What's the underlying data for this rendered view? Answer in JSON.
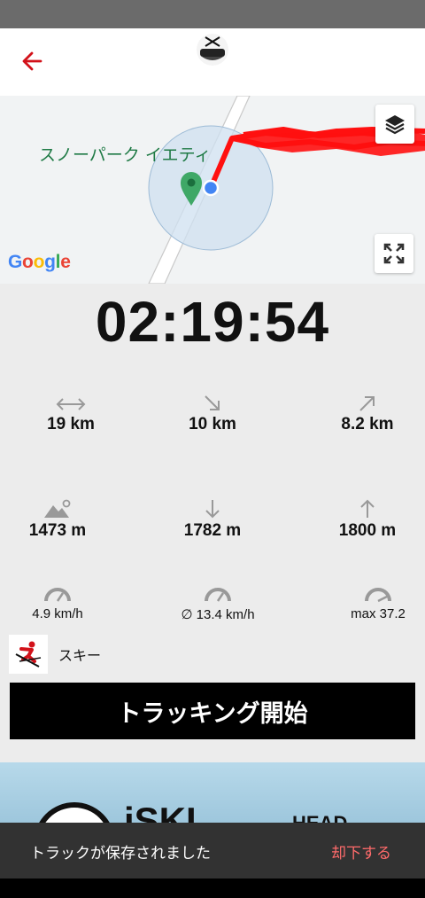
{
  "map": {
    "place_label": "スノーパーク イエティ",
    "attribution": "Google",
    "attribution_colors": [
      "#4285F4",
      "#EA4335",
      "#FBBC05",
      "#4285F4",
      "#34A853",
      "#EA4335"
    ]
  },
  "timer": "02:19:54",
  "stats": {
    "distance": "19 km",
    "descent_distance": "10 km",
    "ascent_distance": "8.2 km",
    "altitude": "1473 m",
    "descent_vertical": "1782 m",
    "ascent_vertical": "1800 m",
    "speed": "4.9 km/h",
    "avg_speed": "∅ 13.4 km/h",
    "max_speed": "max 37.2"
  },
  "activity": {
    "label": "スキー"
  },
  "start_button": "トラッキング開始",
  "snackbar": {
    "message": "トラックが保存されました",
    "action": "却下する"
  },
  "colors": {
    "accent": "#d2121a",
    "track": "#ff0000",
    "snackbar_action": "#ff6b6b"
  }
}
